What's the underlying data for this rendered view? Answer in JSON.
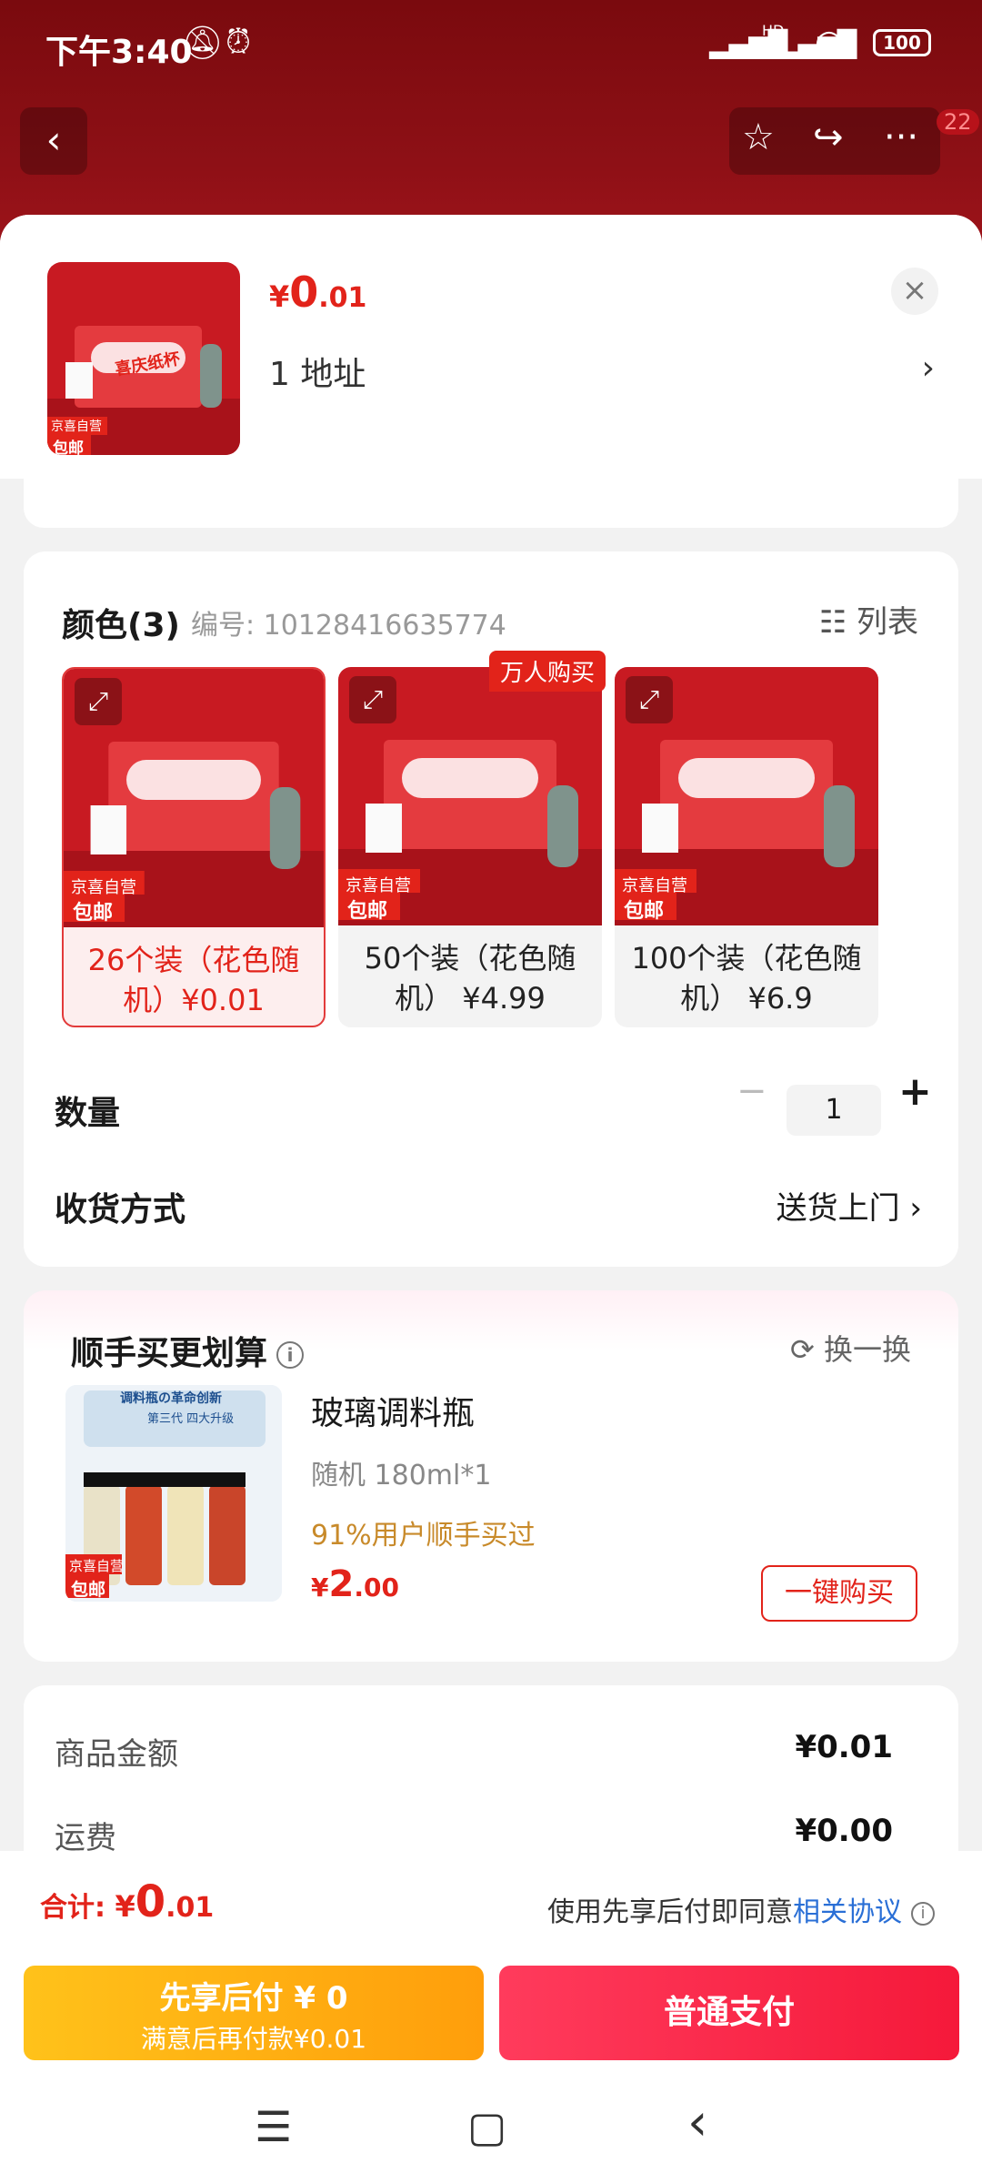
{
  "status_bar": {
    "time": "下午3:40",
    "battery": "100",
    "signal_label": "HD"
  },
  "nav": {
    "back_icon": "‹",
    "star_icon": "☆",
    "share_icon": "↪",
    "more_icon": "···",
    "badge": "22"
  },
  "header": {
    "price_symbol": "¥",
    "price_int": "0",
    "price_dec": ".01",
    "address": "1  地址",
    "thumb_tags": [
      "京喜自营",
      "包邮"
    ],
    "thumb_product_text": "喜庆纸杯"
  },
  "color_section": {
    "title": "颜色(3)",
    "code": "编号: 10128416635774",
    "list_label": "列表",
    "hot_tag": "万人购买",
    "variants": [
      {
        "line1": "26个装（花色随",
        "line2": "机）¥0.01",
        "selected": true
      },
      {
        "line1": "50个装（花色随",
        "line2": "机） ¥4.99",
        "selected": false
      },
      {
        "line1": "100个装（花色随",
        "line2": "机） ¥6.9",
        "selected": false
      }
    ]
  },
  "quantity": {
    "label": "数量",
    "value": "1",
    "minus": "−",
    "plus": "+"
  },
  "delivery": {
    "label": "收货方式",
    "value": "送货上门",
    "arrow": "›"
  },
  "upsell": {
    "title": "顺手买更划算",
    "swap_label": "换一换",
    "name": "玻璃调料瓶",
    "spec": "随机   180ml*1",
    "stat": "91%用户顺手买过",
    "price_symbol": "¥",
    "price_int": "2",
    "price_dec": ".00",
    "buy_label": "一键购买",
    "img_text1": "调料瓶の革命创新",
    "img_text2": "第三代 四大升级",
    "img_tags": [
      "京喜自营",
      "包邮"
    ]
  },
  "summary": {
    "rows": [
      {
        "label": "商品金额",
        "value": "¥0.01"
      },
      {
        "label": "运费",
        "value": "¥0.00"
      }
    ]
  },
  "bottom": {
    "total_label": "合计: ",
    "total_symbol": "¥",
    "total_int": "0",
    "total_dec": ".01",
    "agree_text": "使用先享后付即同意",
    "agree_link": "相关协议",
    "pay_later_l1": "先享后付 ¥ 0",
    "pay_later_l2": "满意后再付款¥0.01",
    "pay_normal": "普通支付"
  },
  "sysnav": {
    "menu": "☰",
    "home": "▢",
    "back": "‹"
  },
  "colors": {
    "accent": "#e2231a",
    "link": "#2a6fd6",
    "pay_later": "#ffb414",
    "pay_normal": "#f5193a"
  }
}
